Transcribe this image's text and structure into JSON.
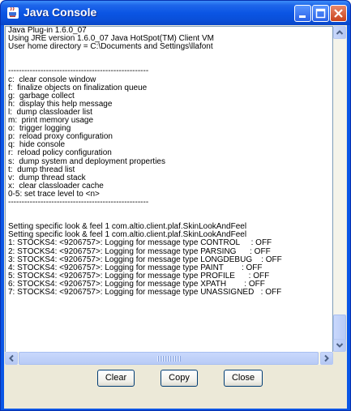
{
  "window": {
    "title": "Java Console"
  },
  "console_lines": [
    "Java Plug-in 1.6.0_07",
    "Using JRE version 1.6.0_07 Java HotSpot(TM) Client VM",
    "User home directory = C:\\Documents and Settings\\llafont",
    "",
    "",
    "----------------------------------------------------",
    "c:  clear console window",
    "f:  finalize objects on finalization queue",
    "g:  garbage collect",
    "h:  display this help message",
    "l:  dump classloader list",
    "m:  print memory usage",
    "o:  trigger logging",
    "p:  reload proxy configuration",
    "q:  hide console",
    "r:  reload policy configuration",
    "s:  dump system and deployment properties",
    "t:  dump thread list",
    "v:  dump thread stack",
    "x:  clear classloader cache",
    "0-5: set trace level to <n>",
    "----------------------------------------------------",
    "",
    "",
    "Setting specific look & feel 1 com.altio.client.plaf.SkinLookAndFeel",
    "Setting specific look & feel 1 com.altio.client.plaf.SkinLookAndFeel",
    "1: STOCKS4: <9206757>: Logging for message type CONTROL     : OFF",
    "2: STOCKS4: <9206757>: Logging for message type PARSING      : OFF",
    "3: STOCKS4: <9206757>: Logging for message type LONGDEBUG    : OFF",
    "4: STOCKS4: <9206757>: Logging for message type PAINT        : OFF",
    "5: STOCKS4: <9206757>: Logging for message type PROFILE      : OFF",
    "6: STOCKS4: <9206757>: Logging for message type XPATH        : OFF",
    "7: STOCKS4: <9206757>: Logging for message type UNASSIGNED   : OFF"
  ],
  "buttons": {
    "clear": "Clear",
    "copy": "Copy",
    "close": "Close"
  }
}
